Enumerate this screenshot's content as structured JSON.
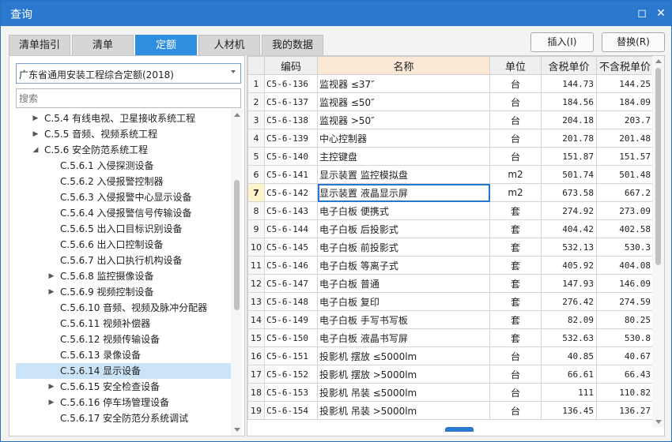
{
  "window": {
    "title": "查询",
    "restore_glyph": "◻",
    "close_glyph": "✕"
  },
  "tabs": [
    {
      "label": "清单指引",
      "active": false
    },
    {
      "label": "清单",
      "active": false
    },
    {
      "label": "定额",
      "active": true
    },
    {
      "label": "人材机",
      "active": false
    },
    {
      "label": "我的数据",
      "active": false
    }
  ],
  "actions": {
    "insert_label": "插入(I)",
    "replace_label": "替换(R)"
  },
  "left": {
    "library_select": "广东省通用安装工程综合定额(2018)",
    "search_placeholder": "搜索",
    "tree": [
      {
        "label": "C.5.4 有线电视、卫星接收系统工程",
        "level": 1,
        "expander": "▶"
      },
      {
        "label": "C.5.5 音频、视频系统工程",
        "level": 1,
        "expander": "▶"
      },
      {
        "label": "C.5.6 安全防范系统工程",
        "level": 1,
        "expander": "◢"
      },
      {
        "label": "C.5.6.1 入侵探测设备",
        "level": 2,
        "expander": ""
      },
      {
        "label": "C.5.6.2 入侵报警控制器",
        "level": 2,
        "expander": ""
      },
      {
        "label": "C.5.6.3 入侵报警中心显示设备",
        "level": 2,
        "expander": ""
      },
      {
        "label": "C.5.6.4 入侵报警信号传输设备",
        "level": 2,
        "expander": ""
      },
      {
        "label": "C.5.6.5 出入口目标识别设备",
        "level": 2,
        "expander": ""
      },
      {
        "label": "C.5.6.6 出入口控制设备",
        "level": 2,
        "expander": ""
      },
      {
        "label": "C.5.6.7 出入口执行机构设备",
        "level": 2,
        "expander": ""
      },
      {
        "label": "C.5.6.8 监控摄像设备",
        "level": 2,
        "expander": "▶"
      },
      {
        "label": "C.5.6.9 视频控制设备",
        "level": 2,
        "expander": "▶"
      },
      {
        "label": "C.5.6.10 音频、视频及脉冲分配器",
        "level": 2,
        "expander": ""
      },
      {
        "label": "C.5.6.11 视频补偿器",
        "level": 2,
        "expander": ""
      },
      {
        "label": "C.5.6.12 视频传输设备",
        "level": 2,
        "expander": ""
      },
      {
        "label": "C.5.6.13 录像设备",
        "level": 2,
        "expander": ""
      },
      {
        "label": "C.5.6.14 显示设备",
        "level": 2,
        "expander": "",
        "selected": true
      },
      {
        "label": "C.5.6.15 安全检查设备",
        "level": 2,
        "expander": "▶"
      },
      {
        "label": "C.5.6.16 停车场管理设备",
        "level": 2,
        "expander": "▶"
      },
      {
        "label": "C.5.6.17 安全防范分系统调试",
        "level": 2,
        "expander": ""
      }
    ]
  },
  "grid": {
    "headers": {
      "rn": "",
      "code": "编码",
      "name": "名称",
      "unit": "单位",
      "tax_price": "含税单价",
      "notax_price": "不含税单价"
    },
    "rows": [
      {
        "n": "1",
        "code": "C5-6-136",
        "name": "监视器 ≤37″",
        "unit": "台",
        "tax": "144.73",
        "notax": "144.25"
      },
      {
        "n": "2",
        "code": "C5-6-137",
        "name": "监视器 ≤50″",
        "unit": "台",
        "tax": "184.56",
        "notax": "184.09"
      },
      {
        "n": "3",
        "code": "C5-6-138",
        "name": "监视器 >50″",
        "unit": "台",
        "tax": "204.18",
        "notax": "203.7"
      },
      {
        "n": "4",
        "code": "C5-6-139",
        "name": "中心控制器",
        "unit": "台",
        "tax": "201.78",
        "notax": "201.48"
      },
      {
        "n": "5",
        "code": "C5-6-140",
        "name": "主控键盘",
        "unit": "台",
        "tax": "151.87",
        "notax": "151.57"
      },
      {
        "n": "6",
        "code": "C5-6-141",
        "name": "显示装置 监控模拟盘",
        "unit": "m2",
        "tax": "501.74",
        "notax": "501.48"
      },
      {
        "n": "7",
        "code": "C5-6-142",
        "name": "显示装置 液晶显示屏",
        "unit": "m2",
        "tax": "673.58",
        "notax": "667.2",
        "active": true
      },
      {
        "n": "8",
        "code": "C5-6-143",
        "name": "电子白板 便携式",
        "unit": "套",
        "tax": "274.92",
        "notax": "273.09"
      },
      {
        "n": "9",
        "code": "C5-6-144",
        "name": "电子白板 后投影式",
        "unit": "套",
        "tax": "404.42",
        "notax": "402.58"
      },
      {
        "n": "10",
        "code": "C5-6-145",
        "name": "电子白板 前投影式",
        "unit": "套",
        "tax": "532.13",
        "notax": "530.3"
      },
      {
        "n": "11",
        "code": "C5-6-146",
        "name": "电子白板 等离子式",
        "unit": "套",
        "tax": "405.92",
        "notax": "404.08"
      },
      {
        "n": "12",
        "code": "C5-6-147",
        "name": "电子白板 普通",
        "unit": "套",
        "tax": "147.93",
        "notax": "146.09"
      },
      {
        "n": "13",
        "code": "C5-6-148",
        "name": "电子白板 复印",
        "unit": "套",
        "tax": "276.42",
        "notax": "274.59"
      },
      {
        "n": "14",
        "code": "C5-6-149",
        "name": "电子白板 手写书写板",
        "unit": "套",
        "tax": "82.09",
        "notax": "80.25"
      },
      {
        "n": "15",
        "code": "C5-6-150",
        "name": "电子白板 液晶书写屏",
        "unit": "套",
        "tax": "532.63",
        "notax": "530.8"
      },
      {
        "n": "16",
        "code": "C5-6-151",
        "name": "投影机 摆放 ≤5000lm",
        "unit": "台",
        "tax": "40.85",
        "notax": "40.67"
      },
      {
        "n": "17",
        "code": "C5-6-152",
        "name": "投影机 摆放 >5000lm",
        "unit": "台",
        "tax": "66.61",
        "notax": "66.43"
      },
      {
        "n": "18",
        "code": "C5-6-153",
        "name": "投影机 吊装 ≤5000lm",
        "unit": "台",
        "tax": "111",
        "notax": "110.82"
      },
      {
        "n": "19",
        "code": "C5-6-154",
        "name": "投影机 吊装 >5000lm",
        "unit": "台",
        "tax": "136.45",
        "notax": "136.27"
      }
    ]
  }
}
